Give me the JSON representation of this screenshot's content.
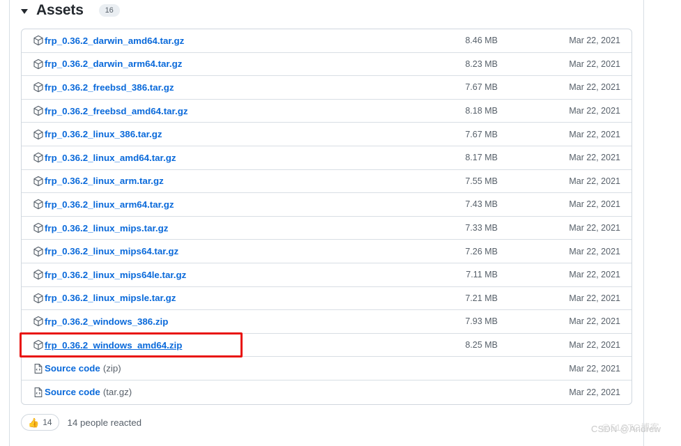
{
  "page": {
    "section_title": "Assets",
    "asset_count": "16",
    "disclosure_state": "expanded"
  },
  "colors": {
    "link": "#0969da",
    "muted_text": "#57606a",
    "border": "#d0d7de",
    "row_divider": "#d8dee4",
    "badge_bg": "#eaeef2",
    "highlight_box": "#e8130f",
    "reaction_emoji": "#eac54f"
  },
  "assets": [
    {
      "icon": "package-icon",
      "name": "frp_0.36.2_darwin_amd64.tar.gz",
      "suffix": "",
      "size": "8.46 MB",
      "date": "Mar 22, 2021",
      "highlighted": false
    },
    {
      "icon": "package-icon",
      "name": "frp_0.36.2_darwin_arm64.tar.gz",
      "suffix": "",
      "size": "8.23 MB",
      "date": "Mar 22, 2021",
      "highlighted": false
    },
    {
      "icon": "package-icon",
      "name": "frp_0.36.2_freebsd_386.tar.gz",
      "suffix": "",
      "size": "7.67 MB",
      "date": "Mar 22, 2021",
      "highlighted": false
    },
    {
      "icon": "package-icon",
      "name": "frp_0.36.2_freebsd_amd64.tar.gz",
      "suffix": "",
      "size": "8.18 MB",
      "date": "Mar 22, 2021",
      "highlighted": false
    },
    {
      "icon": "package-icon",
      "name": "frp_0.36.2_linux_386.tar.gz",
      "suffix": "",
      "size": "7.67 MB",
      "date": "Mar 22, 2021",
      "highlighted": false
    },
    {
      "icon": "package-icon",
      "name": "frp_0.36.2_linux_amd64.tar.gz",
      "suffix": "",
      "size": "8.17 MB",
      "date": "Mar 22, 2021",
      "highlighted": false
    },
    {
      "icon": "package-icon",
      "name": "frp_0.36.2_linux_arm.tar.gz",
      "suffix": "",
      "size": "7.55 MB",
      "date": "Mar 22, 2021",
      "highlighted": false
    },
    {
      "icon": "package-icon",
      "name": "frp_0.36.2_linux_arm64.tar.gz",
      "suffix": "",
      "size": "7.43 MB",
      "date": "Mar 22, 2021",
      "highlighted": false
    },
    {
      "icon": "package-icon",
      "name": "frp_0.36.2_linux_mips.tar.gz",
      "suffix": "",
      "size": "7.33 MB",
      "date": "Mar 22, 2021",
      "highlighted": false
    },
    {
      "icon": "package-icon",
      "name": "frp_0.36.2_linux_mips64.tar.gz",
      "suffix": "",
      "size": "7.26 MB",
      "date": "Mar 22, 2021",
      "highlighted": false
    },
    {
      "icon": "package-icon",
      "name": "frp_0.36.2_linux_mips64le.tar.gz",
      "suffix": "",
      "size": "7.11 MB",
      "date": "Mar 22, 2021",
      "highlighted": false
    },
    {
      "icon": "package-icon",
      "name": "frp_0.36.2_linux_mipsle.tar.gz",
      "suffix": "",
      "size": "7.21 MB",
      "date": "Mar 22, 2021",
      "highlighted": false
    },
    {
      "icon": "package-icon",
      "name": "frp_0.36.2_windows_386.zip",
      "suffix": "",
      "size": "7.93 MB",
      "date": "Mar 22, 2021",
      "highlighted": false
    },
    {
      "icon": "package-icon",
      "name": "frp_0.36.2_windows_amd64.zip",
      "suffix": "",
      "size": "8.25 MB",
      "date": "Mar 22, 2021",
      "highlighted": true
    },
    {
      "icon": "file-code-icon",
      "name": "Source code",
      "suffix": "(zip)",
      "size": "",
      "date": "Mar 22, 2021",
      "highlighted": false
    },
    {
      "icon": "file-code-icon",
      "name": "Source code",
      "suffix": "(tar.gz)",
      "size": "",
      "date": "Mar 22, 2021",
      "highlighted": false
    }
  ],
  "reactions": {
    "emoji": "thumbs-up",
    "emoji_glyph": "👍",
    "count": "14",
    "summary": "14 people reacted"
  },
  "watermarks": {
    "primary": "@51CTO博客",
    "secondary": "CSDN @Andrew"
  }
}
